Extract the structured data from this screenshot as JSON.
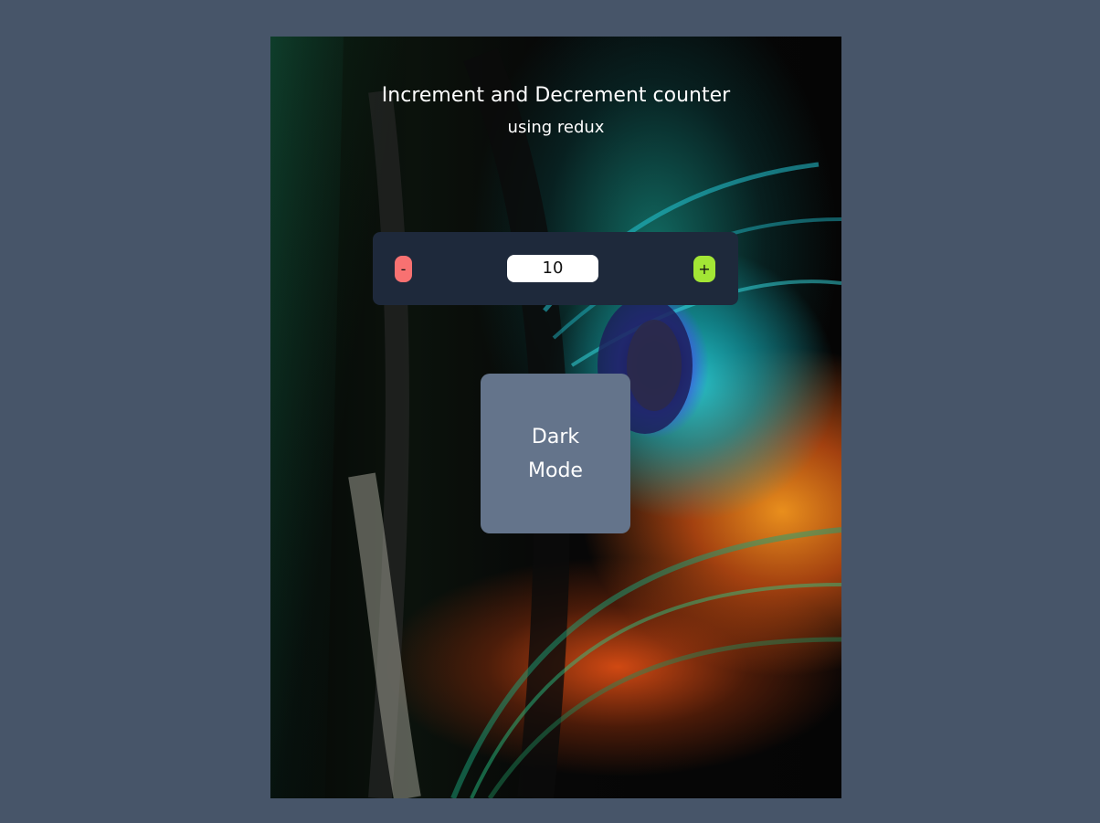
{
  "header": {
    "title": "Increment and Decrement counter",
    "subtitle": "using redux"
  },
  "counter": {
    "decrement_label": "-",
    "value": "10",
    "increment_label": "+",
    "decrement_color": "#f87171",
    "increment_color": "#a3e635",
    "panel_color": "#1e293b"
  },
  "theme_toggle": {
    "label": "Dark Mode",
    "color": "#64748b"
  },
  "background": {
    "page_color": "#475569",
    "image": "peacock-feather-photo"
  }
}
